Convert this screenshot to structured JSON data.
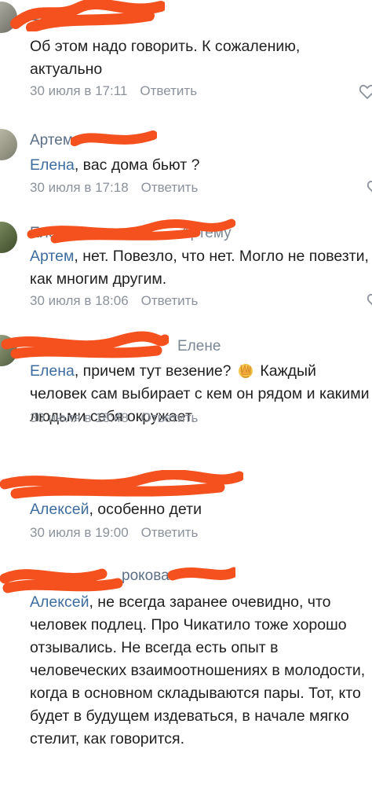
{
  "comments": [
    {
      "author": "Ел",
      "text": "Об этом надо говорить. К сожалению, актуально",
      "time": "30 июля в 17:11",
      "reply": "Ответить"
    },
    {
      "author": "Артем",
      "mention": "Елена",
      "text": ", вас дома бьют ?",
      "time": "30 июля в 17:18",
      "reply": "Ответить"
    },
    {
      "author": "Елена",
      "reply_to": "Артему",
      "mention": "Артем",
      "text": ", нет. Повезло, что нет. Могло не повезти, как многим другим.",
      "time": "30 июля в 18:06",
      "reply": "Ответить"
    },
    {
      "reply_to": "Елене",
      "mention": "Елена",
      "text_before_emoji": ", причем тут везение? ",
      "text_after_emoji": " Каждый человек сам выбирает с кем он рядом и какими людьми себя окружает.",
      "time": "30 июля в 18:48",
      "reply": "Ответить"
    },
    {
      "mention": "Алексей",
      "text": ", особенно дети",
      "time": "30 июля в 19:00",
      "reply": "Ответить"
    },
    {
      "author": "рокова",
      "mention": "Алексей",
      "text": ", не всегда заранее очевидно, что человек подлец. Про Чикатило тоже хорошо отзывались. Не всегда есть опыт в человеческих взаимоотношениях в молодости, когда в основном складываются пары. Тот, кто будет в будущем издеваться, в начале мягко стелит,  как говорится."
    }
  ],
  "colors": {
    "scribble": "#f4511e",
    "mention": "#3e6c9e",
    "meta": "#8b929b"
  }
}
